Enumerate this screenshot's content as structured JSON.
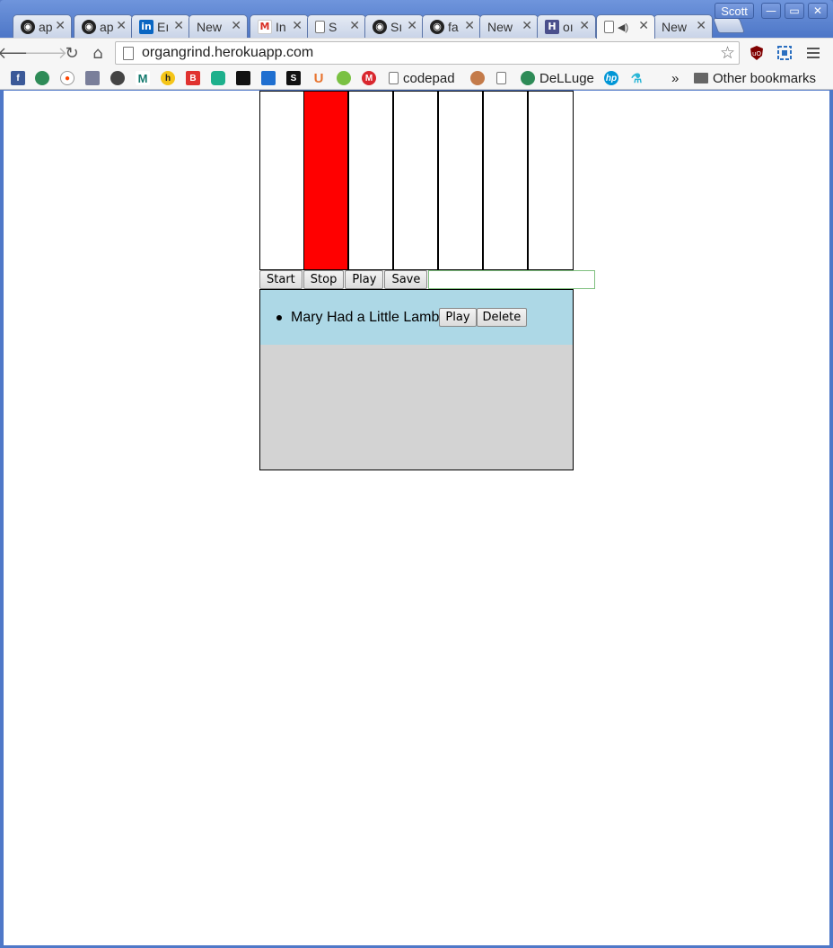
{
  "browser": {
    "profile_name": "Scott",
    "tabs": [
      {
        "title": "ap",
        "icon": "github-icon"
      },
      {
        "title": "ap",
        "icon": "github-icon"
      },
      {
        "title": "Eı",
        "icon": "linkedin-icon"
      },
      {
        "title": "New",
        "icon": ""
      },
      {
        "title": "In",
        "icon": "gmail-icon"
      },
      {
        "title": "S",
        "icon": "page-icon"
      },
      {
        "title": "Sı",
        "icon": "github-icon"
      },
      {
        "title": "fa",
        "icon": "github-icon"
      },
      {
        "title": "New",
        "icon": ""
      },
      {
        "title": "oı",
        "icon": "site-icon"
      },
      {
        "title": "",
        "icon": "page-icon",
        "active": true,
        "audio": true
      },
      {
        "title": "New",
        "icon": ""
      }
    ],
    "url": "organgrind.herokuapp.com",
    "bookmarks": {
      "codepad": "codepad",
      "delluge": "DeLLuge",
      "more": "»",
      "other": "Other bookmarks"
    }
  },
  "organ": {
    "keys": [
      {
        "active": false
      },
      {
        "active": true
      },
      {
        "active": false
      },
      {
        "active": false
      },
      {
        "active": false
      },
      {
        "active": false
      },
      {
        "active": false
      }
    ],
    "active_color": "#ff0000",
    "controls": {
      "start": "Start",
      "stop": "Stop",
      "play": "Play",
      "save": "Save",
      "name_value": ""
    },
    "songs": [
      {
        "title": "Mary Had a Little Lamb",
        "play_label": "Play",
        "delete_label": "Delete"
      }
    ]
  },
  "colors": {
    "song_list_bg": "#add8e6",
    "panel_bg": "#d3d3d3"
  }
}
